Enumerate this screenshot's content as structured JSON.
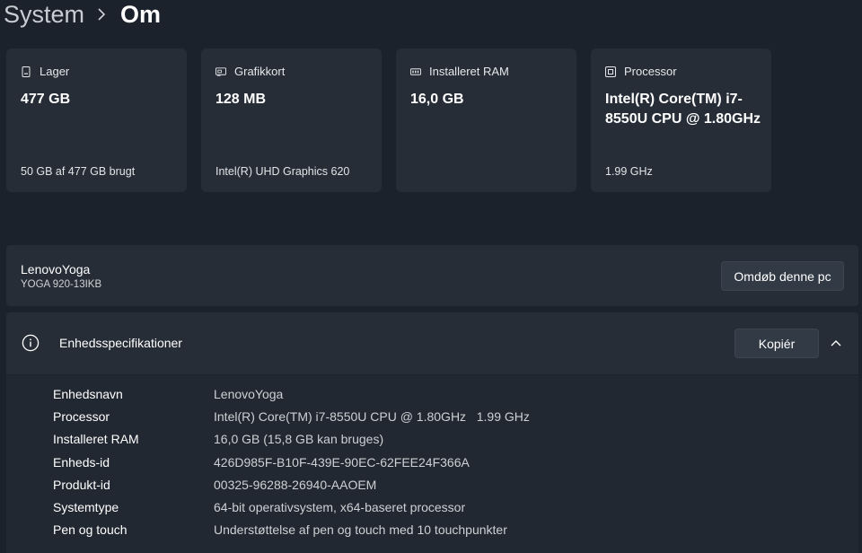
{
  "breadcrumb": {
    "parent": "System",
    "separator_icon": "chevron-right-icon",
    "current": "Om"
  },
  "cards": [
    {
      "icon": "storage-icon",
      "title": "Lager",
      "value": "477 GB",
      "sub": "50 GB af 477 GB brugt"
    },
    {
      "icon": "graphics-card-icon",
      "title": "Grafikkort",
      "value": "128 MB",
      "sub": "Intel(R) UHD Graphics 620"
    },
    {
      "icon": "ram-icon",
      "title": "Installeret RAM",
      "value": "16,0 GB",
      "sub": ""
    },
    {
      "icon": "processor-icon",
      "title": "Processor",
      "value": "Intel(R) Core(TM) i7-8550U CPU @ 1.80GHz",
      "sub": "1.99 GHz"
    }
  ],
  "device": {
    "name": "LenovoYoga",
    "model": "YOGA 920-13IKB",
    "rename_label": "Omdøb denne pc"
  },
  "specs": {
    "icon": "info-icon",
    "title": "Enhedsspecifikationer",
    "copy_label": "Kopiér",
    "collapse_icon": "chevron-up-icon",
    "rows": [
      {
        "label": "Enhedsnavn",
        "value": "LenovoYoga"
      },
      {
        "label": "Processor",
        "value": "Intel(R) Core(TM) i7-8550U CPU @ 1.80GHz   1.99 GHz"
      },
      {
        "label": "Installeret RAM",
        "value": "16,0 GB (15,8 GB kan bruges)"
      },
      {
        "label": "Enheds-id",
        "value": "426D985F-B10F-439E-90EC-62FEE24F366A"
      },
      {
        "label": "Produkt-id",
        "value": "00325-96288-26940-AAOEM"
      },
      {
        "label": "Systemtype",
        "value": "64-bit operativsystem, x64-baseret processor"
      },
      {
        "label": "Pen og touch",
        "value": "Understøttelse af pen og touch med 10 touchpunkter"
      }
    ]
  },
  "colors": {
    "background": "#1c222c",
    "card": "#262d37",
    "button": "#323a45"
  }
}
